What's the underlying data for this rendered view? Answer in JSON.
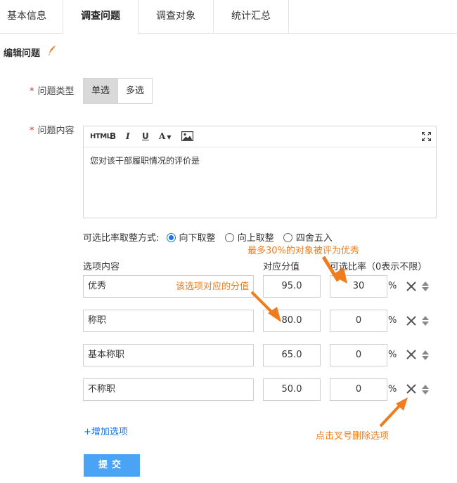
{
  "tabs": [
    {
      "label": "基本信息"
    },
    {
      "label": "调查问题"
    },
    {
      "label": "调查对象"
    },
    {
      "label": "统计汇总"
    }
  ],
  "active_tab": "调查问题",
  "section": {
    "title": "编辑问题",
    "icon": "feather-edit-icon"
  },
  "question_type": {
    "required_mark": "*",
    "label": "问题类型",
    "options": [
      "单选",
      "多选"
    ],
    "selected": "单选"
  },
  "question_content": {
    "required_mark": "*",
    "label": "问题内容",
    "toolbar": {
      "html": "HTML",
      "bold": "B",
      "italic": "I",
      "underline": "U",
      "font_color": "A"
    },
    "text": "您对该干部履职情况的评价是"
  },
  "rounding": {
    "label": "可选比率取整方式:",
    "options": [
      "向下取整",
      "向上取整",
      "四舍五入"
    ],
    "selected": "向下取整"
  },
  "columns": {
    "option": "选项内容",
    "score": "对应分值",
    "ratio": "可选比率（0表示不限）"
  },
  "options": [
    {
      "name": "优秀",
      "score": "95.0",
      "ratio": "30",
      "pct": "%"
    },
    {
      "name": "称职",
      "score": "80.0",
      "ratio": "0",
      "pct": "%"
    },
    {
      "name": "基本称职",
      "score": "65.0",
      "ratio": "0",
      "pct": "%"
    },
    {
      "name": "不称职",
      "score": "50.0",
      "ratio": "0",
      "pct": "%"
    }
  ],
  "add_option": "+增加选项",
  "submit": "提交",
  "annotations": {
    "ratio_note": "最多30%的对象被评为优秀",
    "score_note": "该选项对应的分值",
    "delete_note": "点击叉号删除选项"
  },
  "colors": {
    "accent": "#1a73e8",
    "submit_bg": "#4ba3f5",
    "annotation": "#f07c1e",
    "required": "#e0301e"
  }
}
